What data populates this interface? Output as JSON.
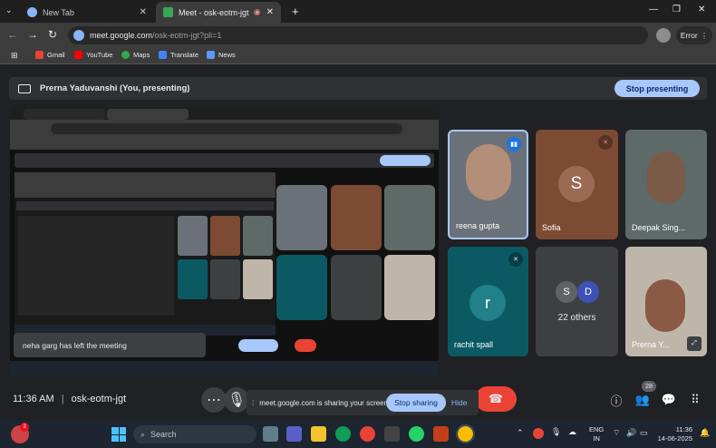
{
  "browser": {
    "tabs": [
      {
        "label": "New Tab",
        "active": false
      },
      {
        "label": "Meet - osk-eotm-jgt",
        "active": true
      }
    ],
    "url_host": "meet.google.com",
    "url_path": "/osk-eotm-jgt?pli=1",
    "profile_label": "Error",
    "bookmarks": [
      "Gmail",
      "YouTube",
      "Maps",
      "Translate",
      "News"
    ]
  },
  "meet": {
    "presenting_text": "Prerna Yaduvanshi (You, presenting)",
    "stop_presenting_label": "Stop presenting",
    "participants": [
      {
        "name": "reena gupta",
        "type": "video",
        "tile_color": "#6b7178"
      },
      {
        "name": "Sofia",
        "type": "avatar",
        "initial": "S",
        "tile_color": "#7d4a33",
        "avatar_color": "#9a6a52"
      },
      {
        "name": "Deepak Sing...",
        "type": "video",
        "tile_color": "#5d6a68"
      },
      {
        "name": "rachit spall",
        "type": "avatar",
        "initial": "r",
        "tile_color": "#0b5a63",
        "avatar_color": "#21808a"
      },
      {
        "name": "22 others",
        "type": "others",
        "initials": [
          "S",
          "D"
        ],
        "tile_color": "#3c4043"
      },
      {
        "name": "Prerna Y...",
        "type": "video",
        "tile_color": "#bfb6aa"
      }
    ],
    "toast": "neha garg has left the meeting",
    "time": "11:36 AM",
    "meeting_code": "osk-eotm-jgt",
    "participant_count": "28",
    "share_notice": "meet.google.com is sharing your screen.",
    "stop_sharing_label": "Stop sharing",
    "hide_label": "Hide"
  },
  "taskbar": {
    "search_placeholder": "Search",
    "lang_top": "ENG",
    "lang_bottom": "IN",
    "clock_time": "11:36",
    "clock_date": "14-06-2025",
    "notification_badge": "3"
  },
  "colors": {
    "accent": "#a8c7fa",
    "end_call": "#ea4335",
    "background": "#202124"
  }
}
